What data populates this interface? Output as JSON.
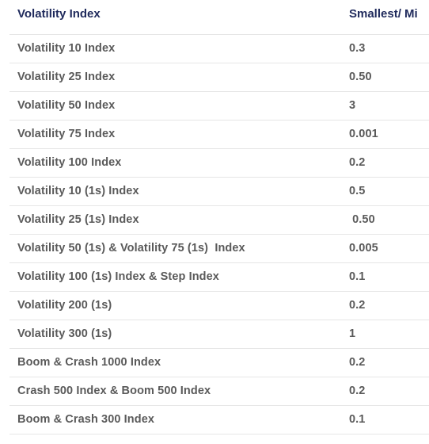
{
  "table": {
    "headers": [
      "Volatility Index",
      "Smallest/ Mi"
    ],
    "rows": [
      {
        "name": "Volatility 10 Index",
        "value": "0.3"
      },
      {
        "name": "Volatility 25 Index",
        "value": "0.50"
      },
      {
        "name": "Volatility 50 Index",
        "value": "3"
      },
      {
        "name": "Volatility 75 Index",
        "value": "0.001"
      },
      {
        "name": "Volatility 100 Index",
        "value": "0.2"
      },
      {
        "name": "Volatility 10 (1s) Index",
        "value": "0.5"
      },
      {
        "name": "Volatility 25 (1s) Index",
        "value": " 0.50"
      },
      {
        "name": "Volatility 50 (1s) & Volatility 75 (1s)  Index",
        "value": "0.005"
      },
      {
        "name": "Volatility 100 (1s) Index & Step Index",
        "value": "0.1"
      },
      {
        "name": "Volatility 200 (1s)",
        "value": "0.2"
      },
      {
        "name": "Volatility 300 (1s)",
        "value": "1"
      },
      {
        "name": "Boom & Crash 1000 Index",
        "value": "0.2"
      },
      {
        "name": "Crash 500 Index & Boom 500 Index",
        "value": "0.2"
      },
      {
        "name": "Boom & Crash 300 Index",
        "value": "0.1"
      }
    ]
  }
}
